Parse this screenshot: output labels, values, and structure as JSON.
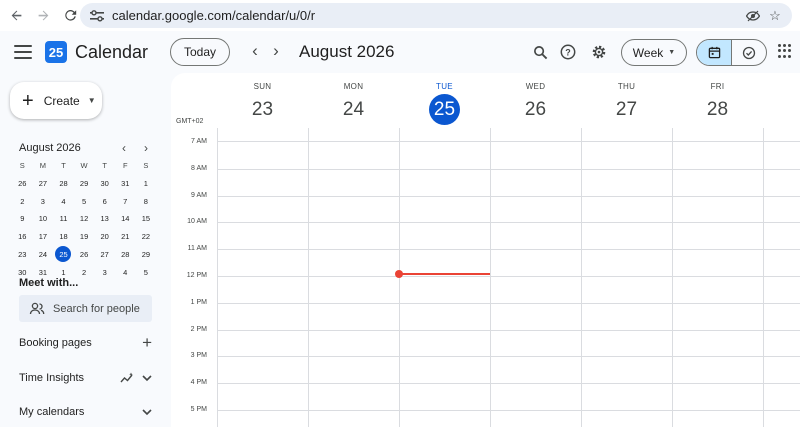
{
  "browser": {
    "url": "calendar.google.com/calendar/u/0/r",
    "icons": [
      "back-arrow-icon",
      "forward-arrow-icon",
      "reload-icon",
      "site-settings-icon",
      "eye-icon",
      "bookmark-star-icon"
    ]
  },
  "header": {
    "logo_text": "25",
    "title": "Calendar",
    "today_label": "Today",
    "prev_label": "‹",
    "next_label": "›",
    "period_label": "August 2026",
    "view_label": "Week"
  },
  "sidebar": {
    "create_label": "Create",
    "mini_calendar": {
      "title": "August 2026",
      "weekdays": [
        "S",
        "M",
        "T",
        "W",
        "T",
        "F",
        "S"
      ],
      "weeks": [
        [
          "26",
          "27",
          "28",
          "29",
          "30",
          "31",
          "1"
        ],
        [
          "2",
          "3",
          "4",
          "5",
          "6",
          "7",
          "8"
        ],
        [
          "9",
          "10",
          "11",
          "12",
          "13",
          "14",
          "15"
        ],
        [
          "16",
          "17",
          "18",
          "19",
          "20",
          "21",
          "22"
        ],
        [
          "23",
          "24",
          "25",
          "26",
          "27",
          "28",
          "29"
        ],
        [
          "30",
          "31",
          "1",
          "2",
          "3",
          "4",
          "5"
        ]
      ],
      "today": "25"
    },
    "meet_with": "Meet with...",
    "search_people_placeholder": "Search for people",
    "booking_pages": "Booking pages",
    "time_insights": "Time Insights",
    "my_calendars": "My calendars"
  },
  "week": {
    "timezone": "GMT+02",
    "days": [
      {
        "dow": "SUN",
        "num": "23"
      },
      {
        "dow": "MON",
        "num": "24"
      },
      {
        "dow": "TUE",
        "num": "25",
        "today": true
      },
      {
        "dow": "WED",
        "num": "26"
      },
      {
        "dow": "THU",
        "num": "27"
      },
      {
        "dow": "FRI",
        "num": "28"
      }
    ],
    "hours": [
      "7 AM",
      "8 AM",
      "9 AM",
      "10 AM",
      "11 AM",
      "12 PM",
      "1 PM",
      "2 PM",
      "3 PM",
      "4 PM",
      "5 PM"
    ]
  },
  "colors": {
    "accent": "#0b57d0",
    "now_line": "#ea4335",
    "selected_view_bg": "#c2e7ff"
  }
}
